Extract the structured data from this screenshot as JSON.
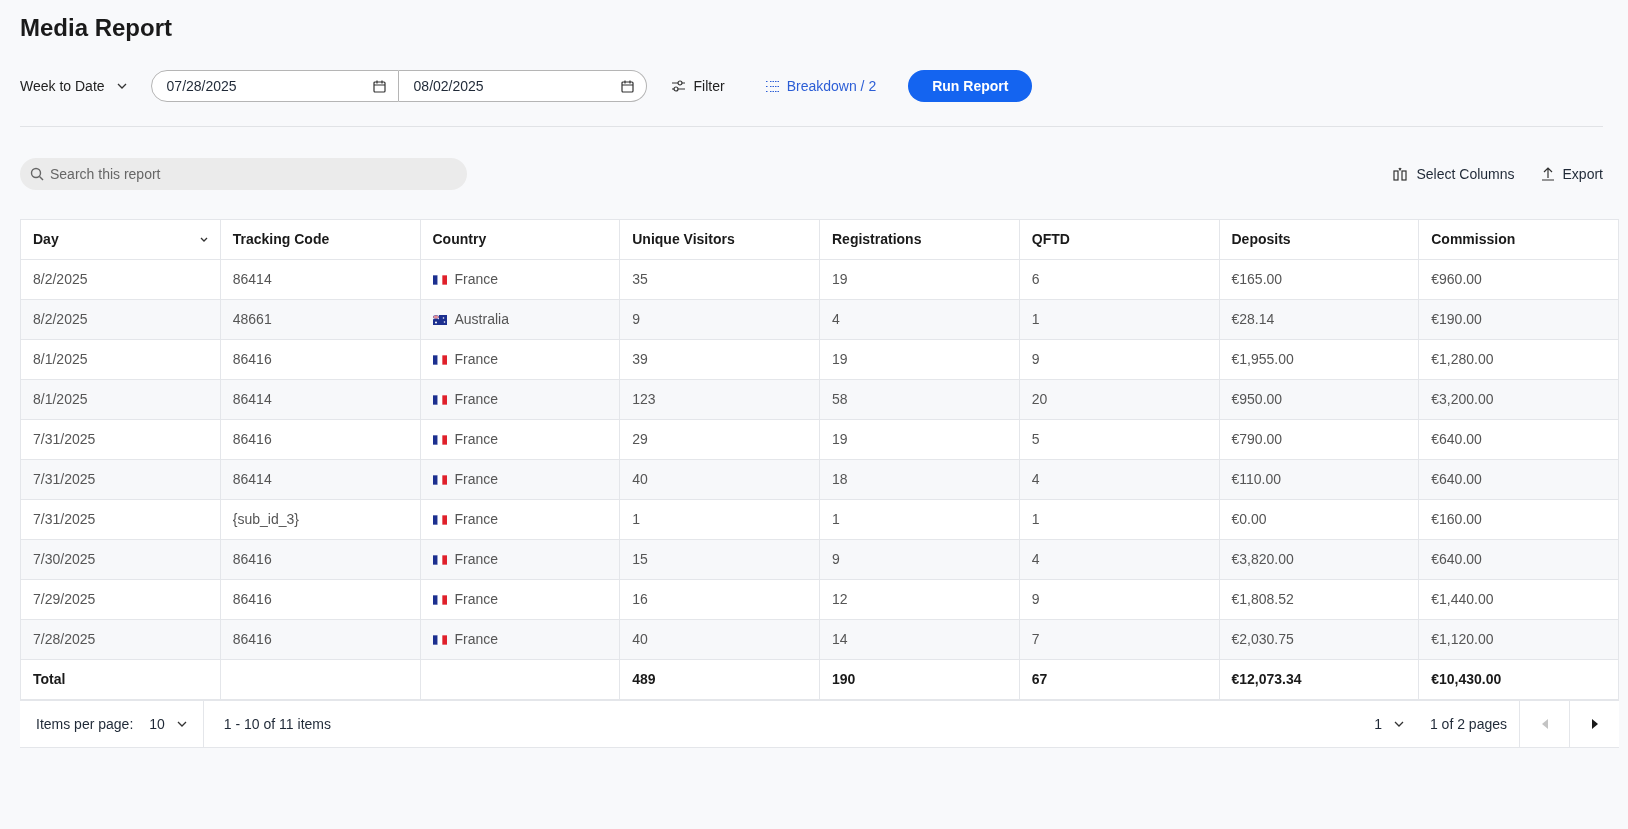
{
  "title": "Media Report",
  "toolbar": {
    "range": "Week to Date",
    "start_date": "07/28/2025",
    "end_date": "08/02/2025",
    "filter": "Filter",
    "breakdown": "Breakdown / 2",
    "run": "Run Report"
  },
  "search": {
    "placeholder": "Search this report"
  },
  "actions": [
    "Select Columns",
    "Export"
  ],
  "table": {
    "columns": [
      {
        "label": "Day",
        "sorted": true
      },
      {
        "label": "Tracking Code",
        "sorted": false
      },
      {
        "label": "Country",
        "sorted": false
      },
      {
        "label": "Unique Visitors",
        "sorted": false
      },
      {
        "label": "Registrations",
        "sorted": false
      },
      {
        "label": "QFTD",
        "sorted": false
      },
      {
        "label": "Deposits",
        "sorted": false
      },
      {
        "label": "Commission",
        "sorted": false
      }
    ],
    "rows": [
      {
        "day": "8/2/2025",
        "code": "86414",
        "country": "France",
        "kind": "fr",
        "visitors": "35",
        "registrations": "19",
        "qftd": "6",
        "deposits": "€165.00",
        "commission": "€960.00"
      },
      {
        "day": "8/2/2025",
        "code": "48661",
        "country": "Australia",
        "kind": "au",
        "visitors": "9",
        "registrations": "4",
        "qftd": "1",
        "deposits": "€28.14",
        "commission": "€190.00"
      },
      {
        "day": "8/1/2025",
        "code": "86416",
        "country": "France",
        "kind": "fr",
        "visitors": "39",
        "registrations": "19",
        "qftd": "9",
        "deposits": "€1,955.00",
        "commission": "€1,280.00"
      },
      {
        "day": "8/1/2025",
        "code": "86414",
        "country": "France",
        "kind": "fr",
        "visitors": "123",
        "registrations": "58",
        "qftd": "20",
        "deposits": "€950.00",
        "commission": "€3,200.00"
      },
      {
        "day": "7/31/2025",
        "code": "86416",
        "country": "France",
        "kind": "fr",
        "visitors": "29",
        "registrations": "19",
        "qftd": "5",
        "deposits": "€790.00",
        "commission": "€640.00"
      },
      {
        "day": "7/31/2025",
        "code": "86414",
        "country": "France",
        "kind": "fr",
        "visitors": "40",
        "registrations": "18",
        "qftd": "4",
        "deposits": "€110.00",
        "commission": "€640.00"
      },
      {
        "day": "7/31/2025",
        "code": "{sub_id_3}",
        "country": "France",
        "kind": "fr",
        "visitors": "1",
        "registrations": "1",
        "qftd": "1",
        "deposits": "€0.00",
        "commission": "€160.00"
      },
      {
        "day": "7/30/2025",
        "code": "86416",
        "country": "France",
        "kind": "fr",
        "visitors": "15",
        "registrations": "9",
        "qftd": "4",
        "deposits": "€3,820.00",
        "commission": "€640.00"
      },
      {
        "day": "7/29/2025",
        "code": "86416",
        "country": "France",
        "kind": "fr",
        "visitors": "16",
        "registrations": "12",
        "qftd": "9",
        "deposits": "€1,808.52",
        "commission": "€1,440.00"
      },
      {
        "day": "7/28/2025",
        "code": "86416",
        "country": "France",
        "kind": "fr",
        "visitors": "40",
        "registrations": "14",
        "qftd": "7",
        "deposits": "€2,030.75",
        "commission": "€1,120.00"
      }
    ],
    "total": {
      "label": "Total",
      "visitors": "489",
      "registrations": "190",
      "qftd": "67",
      "deposits": "€12,073.34",
      "commission": "€10,430.00"
    }
  },
  "pager": {
    "items_label": "Items per page:",
    "page_size": "10",
    "range": "1 - 10 of 11 items",
    "page": "1",
    "pages": "1 of 2 pages",
    "prev_disabled": true,
    "next_disabled": false
  }
}
